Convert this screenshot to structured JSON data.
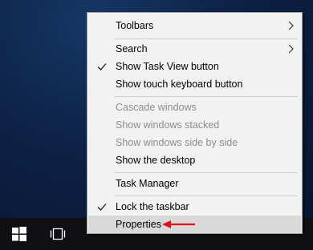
{
  "taskbar": {
    "start_icon": "windows-start-icon",
    "task_view_icon": "task-view-icon"
  },
  "context_menu": {
    "items": [
      {
        "label": "Toolbars",
        "submenu": true,
        "checked": false,
        "enabled": true
      },
      {
        "label": "Search",
        "submenu": true,
        "checked": false,
        "enabled": true
      },
      {
        "label": "Show Task View button",
        "submenu": false,
        "checked": true,
        "enabled": true
      },
      {
        "label": "Show touch keyboard button",
        "submenu": false,
        "checked": false,
        "enabled": true
      },
      {
        "label": "Cascade windows",
        "submenu": false,
        "checked": false,
        "enabled": false
      },
      {
        "label": "Show windows stacked",
        "submenu": false,
        "checked": false,
        "enabled": false
      },
      {
        "label": "Show windows side by side",
        "submenu": false,
        "checked": false,
        "enabled": false
      },
      {
        "label": "Show the desktop",
        "submenu": false,
        "checked": false,
        "enabled": true
      },
      {
        "label": "Task Manager",
        "submenu": false,
        "checked": false,
        "enabled": true
      },
      {
        "label": "Lock the taskbar",
        "submenu": false,
        "checked": true,
        "enabled": true
      },
      {
        "label": "Properties",
        "submenu": false,
        "checked": false,
        "enabled": true,
        "highlighted": true
      }
    ]
  },
  "colors": {
    "annotation_arrow": "#e0101a",
    "menu_background": "#f2f2f2",
    "highlight": "#d9d9d9",
    "taskbar": "#101014"
  }
}
